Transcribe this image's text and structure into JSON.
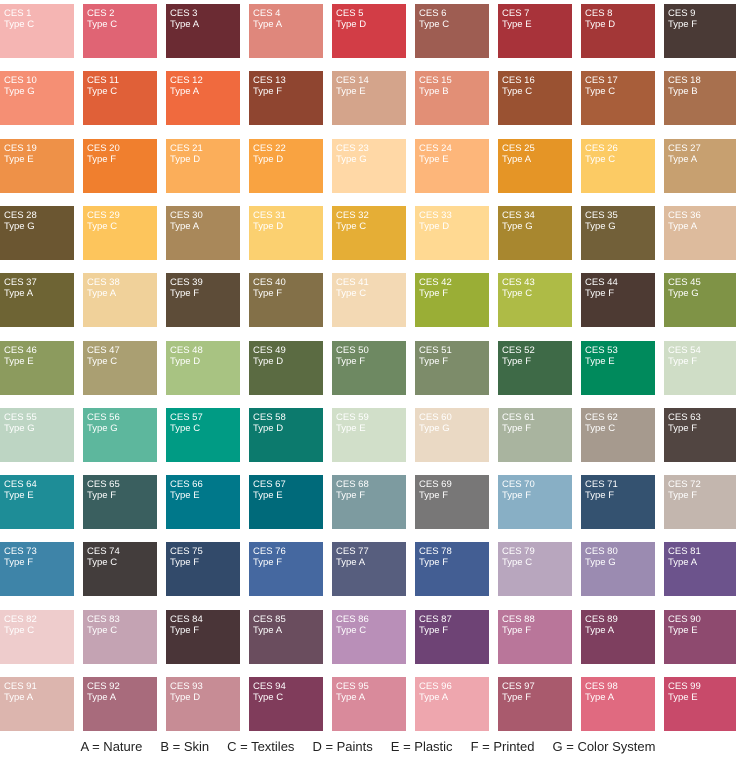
{
  "swatches": [
    {
      "code": "CES 1",
      "type": "Type C",
      "color": "#F5B5B3"
    },
    {
      "code": "CES 2",
      "type": "Type C",
      "color": "#E06474"
    },
    {
      "code": "CES 3",
      "type": "Type A",
      "color": "#6B2B33"
    },
    {
      "code": "CES 4",
      "type": "Type A",
      "color": "#DF877C"
    },
    {
      "code": "CES 5",
      "type": "Type D",
      "color": "#D23D46"
    },
    {
      "code": "CES 6",
      "type": "Type C",
      "color": "#9E5D52"
    },
    {
      "code": "CES 7",
      "type": "Type E",
      "color": "#A8333A"
    },
    {
      "code": "CES 8",
      "type": "Type D",
      "color": "#A33737"
    },
    {
      "code": "CES 9",
      "type": "Type F",
      "color": "#4A3A36"
    },
    {
      "code": "CES 10",
      "type": "Type G",
      "color": "#F58F74"
    },
    {
      "code": "CES 11",
      "type": "Type C",
      "color": "#E06038"
    },
    {
      "code": "CES 12",
      "type": "Type A",
      "color": "#F06A3E"
    },
    {
      "code": "CES 13",
      "type": "Type F",
      "color": "#8F4530"
    },
    {
      "code": "CES 14",
      "type": "Type E",
      "color": "#D4A48B"
    },
    {
      "code": "CES 15",
      "type": "Type B",
      "color": "#E28F76"
    },
    {
      "code": "CES 16",
      "type": "Type C",
      "color": "#9A5232"
    },
    {
      "code": "CES 17",
      "type": "Type C",
      "color": "#A85E3A"
    },
    {
      "code": "CES 18",
      "type": "Type B",
      "color": "#A8704E"
    },
    {
      "code": "CES 19",
      "type": "Type E",
      "color": "#EE9148"
    },
    {
      "code": "CES 20",
      "type": "Type F",
      "color": "#F07F2E"
    },
    {
      "code": "CES 21",
      "type": "Type D",
      "color": "#FBAE5A"
    },
    {
      "code": "CES 22",
      "type": "Type D",
      "color": "#F9A341"
    },
    {
      "code": "CES 23",
      "type": "Type G",
      "color": "#FFD8A6"
    },
    {
      "code": "CES 24",
      "type": "Type E",
      "color": "#FDB67A"
    },
    {
      "code": "CES 25",
      "type": "Type A",
      "color": "#E59526"
    },
    {
      "code": "CES 26",
      "type": "Type C",
      "color": "#FCCB64"
    },
    {
      "code": "CES 27",
      "type": "Type A",
      "color": "#C7A070"
    },
    {
      "code": "CES 28",
      "type": "Type G",
      "color": "#6B5631"
    },
    {
      "code": "CES 29",
      "type": "Type C",
      "color": "#FDC55C"
    },
    {
      "code": "CES 30",
      "type": "Type A",
      "color": "#A9885A"
    },
    {
      "code": "CES 31",
      "type": "Type D",
      "color": "#FBD070"
    },
    {
      "code": "CES 32",
      "type": "Type C",
      "color": "#E5AE36"
    },
    {
      "code": "CES 33",
      "type": "Type D",
      "color": "#FFD992"
    },
    {
      "code": "CES 34",
      "type": "Type G",
      "color": "#A8872F"
    },
    {
      "code": "CES 35",
      "type": "Type G",
      "color": "#726039"
    },
    {
      "code": "CES 36",
      "type": "Type A",
      "color": "#DDBB9D"
    },
    {
      "code": "CES 37",
      "type": "Type A",
      "color": "#6E6434"
    },
    {
      "code": "CES 38",
      "type": "Type A",
      "color": "#F0D19A"
    },
    {
      "code": "CES 39",
      "type": "Type F",
      "color": "#5D4C38"
    },
    {
      "code": "CES 40",
      "type": "Type F",
      "color": "#837048"
    },
    {
      "code": "CES 41",
      "type": "Type C",
      "color": "#F3D9B4"
    },
    {
      "code": "CES 42",
      "type": "Type F",
      "color": "#9AAE36"
    },
    {
      "code": "CES 43",
      "type": "Type C",
      "color": "#AEBB46"
    },
    {
      "code": "CES 44",
      "type": "Type F",
      "color": "#4D3A33"
    },
    {
      "code": "CES 45",
      "type": "Type G",
      "color": "#7F9346"
    },
    {
      "code": "CES 46",
      "type": "Type E",
      "color": "#8C9B5E"
    },
    {
      "code": "CES 47",
      "type": "Type C",
      "color": "#AA9F72"
    },
    {
      "code": "CES 48",
      "type": "Type D",
      "color": "#A8C382"
    },
    {
      "code": "CES 49",
      "type": "Type D",
      "color": "#5B6B42"
    },
    {
      "code": "CES 50",
      "type": "Type F",
      "color": "#6E8962"
    },
    {
      "code": "CES 51",
      "type": "Type F",
      "color": "#7D8C6A"
    },
    {
      "code": "CES 52",
      "type": "Type F",
      "color": "#3E6A47"
    },
    {
      "code": "CES 53",
      "type": "Type E",
      "color": "#008A5C"
    },
    {
      "code": "CES 54",
      "type": "Type F",
      "color": "#CFDDC6"
    },
    {
      "code": "CES 55",
      "type": "Type G",
      "color": "#BDD5C3"
    },
    {
      "code": "CES 56",
      "type": "Type G",
      "color": "#5DB79D"
    },
    {
      "code": "CES 57",
      "type": "Type C",
      "color": "#009B84"
    },
    {
      "code": "CES 58",
      "type": "Type D",
      "color": "#0C7A6D"
    },
    {
      "code": "CES 59",
      "type": "Type E",
      "color": "#D1DFC9"
    },
    {
      "code": "CES 60",
      "type": "Type G",
      "color": "#EAD9C4"
    },
    {
      "code": "CES 61",
      "type": "Type F",
      "color": "#A9B49F"
    },
    {
      "code": "CES 62",
      "type": "Type C",
      "color": "#A69A8E"
    },
    {
      "code": "CES 63",
      "type": "Type F",
      "color": "#514541"
    },
    {
      "code": "CES 64",
      "type": "Type E",
      "color": "#1E8D97"
    },
    {
      "code": "CES 65",
      "type": "Type F",
      "color": "#3A5F5F"
    },
    {
      "code": "CES 66",
      "type": "Type E",
      "color": "#00788A"
    },
    {
      "code": "CES 67",
      "type": "Type E",
      "color": "#006A7A"
    },
    {
      "code": "CES 68",
      "type": "Type F",
      "color": "#7D9BA0"
    },
    {
      "code": "CES 69",
      "type": "Type F",
      "color": "#787777"
    },
    {
      "code": "CES 70",
      "type": "Type F",
      "color": "#88AFC5"
    },
    {
      "code": "CES 71",
      "type": "Type F",
      "color": "#345270"
    },
    {
      "code": "CES 72",
      "type": "Type F",
      "color": "#C3B6AE"
    },
    {
      "code": "CES 73",
      "type": "Type F",
      "color": "#3E84A8"
    },
    {
      "code": "CES 74",
      "type": "Type C",
      "color": "#433D3C"
    },
    {
      "code": "CES 75",
      "type": "Type F",
      "color": "#324A6A"
    },
    {
      "code": "CES 76",
      "type": "Type F",
      "color": "#4568A0"
    },
    {
      "code": "CES 77",
      "type": "Type A",
      "color": "#575E7E"
    },
    {
      "code": "CES 78",
      "type": "Type F",
      "color": "#435E93"
    },
    {
      "code": "CES 79",
      "type": "Type C",
      "color": "#B8A6BE"
    },
    {
      "code": "CES 80",
      "type": "Type G",
      "color": "#9B8BB1"
    },
    {
      "code": "CES 81",
      "type": "Type A",
      "color": "#6C538C"
    },
    {
      "code": "CES 82",
      "type": "Type C",
      "color": "#EECCCC"
    },
    {
      "code": "CES 83",
      "type": "Type C",
      "color": "#C4A3B3"
    },
    {
      "code": "CES 84",
      "type": "Type F",
      "color": "#4A3538"
    },
    {
      "code": "CES 85",
      "type": "Type A",
      "color": "#6A4D5E"
    },
    {
      "code": "CES 86",
      "type": "Type C",
      "color": "#B98FB8"
    },
    {
      "code": "CES 87",
      "type": "Type F",
      "color": "#6E4375"
    },
    {
      "code": "CES 88",
      "type": "Type F",
      "color": "#B9769A"
    },
    {
      "code": "CES 89",
      "type": "Type A",
      "color": "#7E3F5F"
    },
    {
      "code": "CES 90",
      "type": "Type E",
      "color": "#8E4A6F"
    },
    {
      "code": "CES 91",
      "type": "Type A",
      "color": "#DCB5AE"
    },
    {
      "code": "CES 92",
      "type": "Type A",
      "color": "#A86B7C"
    },
    {
      "code": "CES 93",
      "type": "Type D",
      "color": "#C78C95"
    },
    {
      "code": "CES 94",
      "type": "Type C",
      "color": "#803C5B"
    },
    {
      "code": "CES 95",
      "type": "Type A",
      "color": "#D98A9B"
    },
    {
      "code": "CES 96",
      "type": "Type A",
      "color": "#EEA6AE"
    },
    {
      "code": "CES 97",
      "type": "Type F",
      "color": "#A95A6D"
    },
    {
      "code": "CES 98",
      "type": "Type A",
      "color": "#E06A80"
    },
    {
      "code": "CES 99",
      "type": "Type E",
      "color": "#C84A6A"
    }
  ],
  "legend": [
    "A = Nature",
    "B = Skin",
    "C = Textiles",
    "D = Paints",
    "E = Plastic",
    "F = Printed",
    "G = Color System"
  ]
}
